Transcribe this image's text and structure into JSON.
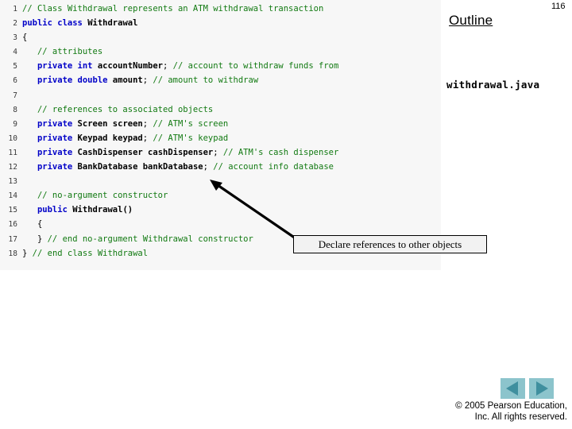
{
  "slide": {
    "page_number": "116",
    "outline_heading": "Outline",
    "outline_filename": "withdrawal.java"
  },
  "code": {
    "language": "java",
    "lines": [
      {
        "n": "1",
        "tokens": [
          {
            "t": "cm",
            "s": "// Class Withdrawal represents an ATM withdrawal transaction"
          }
        ]
      },
      {
        "n": "2",
        "tokens": [
          {
            "t": "kw",
            "s": "public class "
          },
          {
            "t": "id",
            "s": "Withdrawal"
          }
        ]
      },
      {
        "n": "3",
        "tokens": [
          {
            "t": "pl",
            "s": "{"
          }
        ]
      },
      {
        "n": "4",
        "tokens": [
          {
            "t": "pl",
            "s": "   "
          },
          {
            "t": "cm",
            "s": "// attributes"
          }
        ]
      },
      {
        "n": "5",
        "tokens": [
          {
            "t": "pl",
            "s": "   "
          },
          {
            "t": "kw",
            "s": "private int "
          },
          {
            "t": "id",
            "s": "accountNumber"
          },
          {
            "t": "pl",
            "s": "; "
          },
          {
            "t": "cm",
            "s": "// account to withdraw funds from"
          }
        ]
      },
      {
        "n": "6",
        "tokens": [
          {
            "t": "pl",
            "s": "   "
          },
          {
            "t": "kw",
            "s": "private double "
          },
          {
            "t": "id",
            "s": "amount"
          },
          {
            "t": "pl",
            "s": "; "
          },
          {
            "t": "cm",
            "s": "// amount to withdraw"
          }
        ]
      },
      {
        "n": "7",
        "tokens": [
          {
            "t": "pl",
            "s": ""
          }
        ]
      },
      {
        "n": "8",
        "tokens": [
          {
            "t": "pl",
            "s": "   "
          },
          {
            "t": "cm",
            "s": "// references to associated objects"
          }
        ]
      },
      {
        "n": "9",
        "tokens": [
          {
            "t": "pl",
            "s": "   "
          },
          {
            "t": "kw",
            "s": "private "
          },
          {
            "t": "id",
            "s": "Screen screen"
          },
          {
            "t": "pl",
            "s": "; "
          },
          {
            "t": "cm",
            "s": "// ATM's screen"
          }
        ]
      },
      {
        "n": "10",
        "tokens": [
          {
            "t": "pl",
            "s": "   "
          },
          {
            "t": "kw",
            "s": "private "
          },
          {
            "t": "id",
            "s": "Keypad keypad"
          },
          {
            "t": "pl",
            "s": "; "
          },
          {
            "t": "cm",
            "s": "// ATM's keypad"
          }
        ]
      },
      {
        "n": "11",
        "tokens": [
          {
            "t": "pl",
            "s": "   "
          },
          {
            "t": "kw",
            "s": "private "
          },
          {
            "t": "id",
            "s": "CashDispenser cashDispenser"
          },
          {
            "t": "pl",
            "s": "; "
          },
          {
            "t": "cm",
            "s": "// ATM's cash dispenser"
          }
        ]
      },
      {
        "n": "12",
        "tokens": [
          {
            "t": "pl",
            "s": "   "
          },
          {
            "t": "kw",
            "s": "private "
          },
          {
            "t": "id",
            "s": "BankDatabase bankDatabase"
          },
          {
            "t": "pl",
            "s": "; "
          },
          {
            "t": "cm",
            "s": "// account info database"
          }
        ]
      },
      {
        "n": "13",
        "tokens": [
          {
            "t": "pl",
            "s": ""
          }
        ]
      },
      {
        "n": "14",
        "tokens": [
          {
            "t": "pl",
            "s": "   "
          },
          {
            "t": "cm",
            "s": "// no-argument constructor"
          }
        ]
      },
      {
        "n": "15",
        "tokens": [
          {
            "t": "pl",
            "s": "   "
          },
          {
            "t": "kw",
            "s": "public "
          },
          {
            "t": "id",
            "s": "Withdrawal()"
          }
        ]
      },
      {
        "n": "16",
        "tokens": [
          {
            "t": "pl",
            "s": "   {"
          }
        ]
      },
      {
        "n": "17",
        "tokens": [
          {
            "t": "pl",
            "s": "   } "
          },
          {
            "t": "cm",
            "s": "// end no-argument Withdrawal constructor"
          }
        ]
      },
      {
        "n": "18",
        "tokens": [
          {
            "t": "pl",
            "s": "} "
          },
          {
            "t": "cm",
            "s": "// end class Withdrawal"
          }
        ]
      }
    ]
  },
  "callout": {
    "text": "Declare references to other objects"
  },
  "navigation": {
    "prev_label": "previous-slide",
    "next_label": "next-slide"
  },
  "footer": {
    "line1": "© 2005 Pearson Education,",
    "line2": "Inc.  All rights reserved."
  },
  "colors": {
    "keyword": "#0000c8",
    "comment": "#127a12",
    "code_background": "#f7f7f7",
    "nav_button_face": "#8cc4cc",
    "nav_button_arrow": "#3f8f9e"
  }
}
